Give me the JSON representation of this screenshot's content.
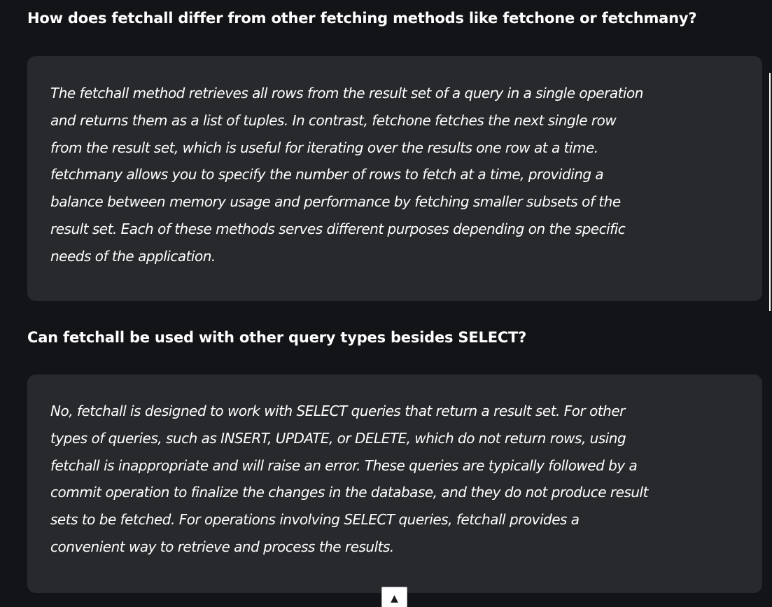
{
  "faq": [
    {
      "question": "How does fetchall differ from other fetching methods like fetchone or fetchmany?",
      "answer_lines": [
        "The fetchall method retrieves all rows from the result set of a query in a single operation",
        "and returns them as a list of tuples. In contrast, fetchone fetches the next single row",
        "from the result set, which is useful for iterating over the results one row at a time.",
        "fetchmany allows you to specify the number of rows to fetch at a time, providing a",
        "balance between memory usage and performance by fetching smaller subsets of the",
        "result set. Each of these methods serves different purposes depending on the specific",
        "needs of the application."
      ]
    },
    {
      "question": "Can fetchall be used with other query types besides SELECT?",
      "answer_lines": [
        "No, fetchall is designed to work with SELECT queries that return a result set. For other",
        "types of queries, such as INSERT, UPDATE, or DELETE, which do not return rows, using",
        "fetchall is inappropriate and will raise an error. These queries are typically followed by a",
        "commit operation to finalize the changes in the database, and they do not produce result",
        "sets to be fetched. For operations involving SELECT queries, fetchall provides a",
        "convenient way to retrieve and process the results."
      ]
    }
  ],
  "scroll_top": {
    "icon": "up-arrow-icon",
    "glyph": "▲"
  },
  "colors": {
    "background": "#131417",
    "card": "#28292d",
    "text": "#ffffff"
  }
}
